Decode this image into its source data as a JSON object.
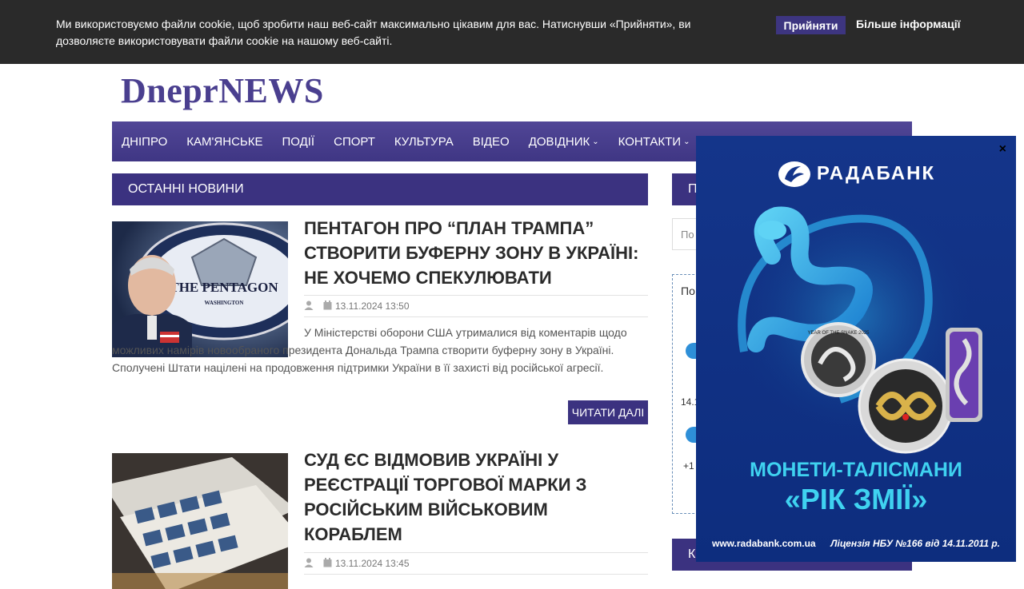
{
  "cookie": {
    "text": "Ми використовуємо файли cookie, щоб зробити наш веб-сайт максимально цікавим для вас. Натиснувши «Прийняти», ви дозволяєте використовувати файли cookie на нашому веб-сайті.",
    "accept_label": "Прийняти",
    "more_label": "Більше інформації"
  },
  "site": {
    "logo": "DneprNEWS"
  },
  "nav": {
    "items": [
      {
        "label": "ДНІПРО",
        "dropdown": false
      },
      {
        "label": "КАМ'ЯНСЬКЕ",
        "dropdown": false
      },
      {
        "label": "ПОДІЇ",
        "dropdown": false
      },
      {
        "label": "СПОРТ",
        "dropdown": false
      },
      {
        "label": "КУЛЬТУРА",
        "dropdown": false
      },
      {
        "label": "ВІДЕО",
        "dropdown": false
      },
      {
        "label": "ДОВІДНИК",
        "dropdown": true
      },
      {
        "label": "КОНТАКТИ",
        "dropdown": true
      }
    ]
  },
  "main": {
    "section_title": "ОСТАННІ НОВИНИ",
    "articles": [
      {
        "title": "ПЕНТАГОН ПРО “ПЛАН ТРАМПА” СТВОРИТИ БУФЕРНУ ЗОНУ В УКРАЇНІ: НЕ ХОЧЕМО СПЕКУЛЮВАТИ",
        "date": "13.11.2024 13:50",
        "excerpt": "У Міністерстві оборони США утрималися від коментарів щодо можливих намірів новообраного президента Дональда Трампа створити буферну зону в Україні. Сполучені Штати націлені на продовження підтримки України в її захисті від російської агресії.",
        "read_more": "ЧИТАТИ ДАЛІ",
        "image_caption": "THE PENTAGON",
        "image_subcaption": "WASHINGTON"
      },
      {
        "title": "СУД ЄС ВІДМОВИВ УКРАЇНІ У РЕЄСТРАЦІЇ ТОРГОВОЇ МАРКИ З РОСІЙСЬКИМ ВІЙСЬКОВИМ КОРАБЛЕМ",
        "date": "13.11.2024 13:45"
      }
    ]
  },
  "sidebar": {
    "section_title_partial": "П",
    "search_placeholder_partial": "По",
    "weather_title_partial": "По",
    "weather_date_partial": "14.1",
    "weather_temp_partial": "+1",
    "bottom_section_partial": "К"
  },
  "ad": {
    "brand": "РАДАБАНК",
    "coin_text": "YEAR OF THE SNAKE 2025",
    "headline_line1": "МОНЕТИ-ТАЛІСМАНИ",
    "headline_line2": "«РІК ЗМІЇ»",
    "url": "www.radabank.com.ua",
    "license": "Ліцензія НБУ №166 від 14.11.2011 р.",
    "close_label": "×"
  }
}
